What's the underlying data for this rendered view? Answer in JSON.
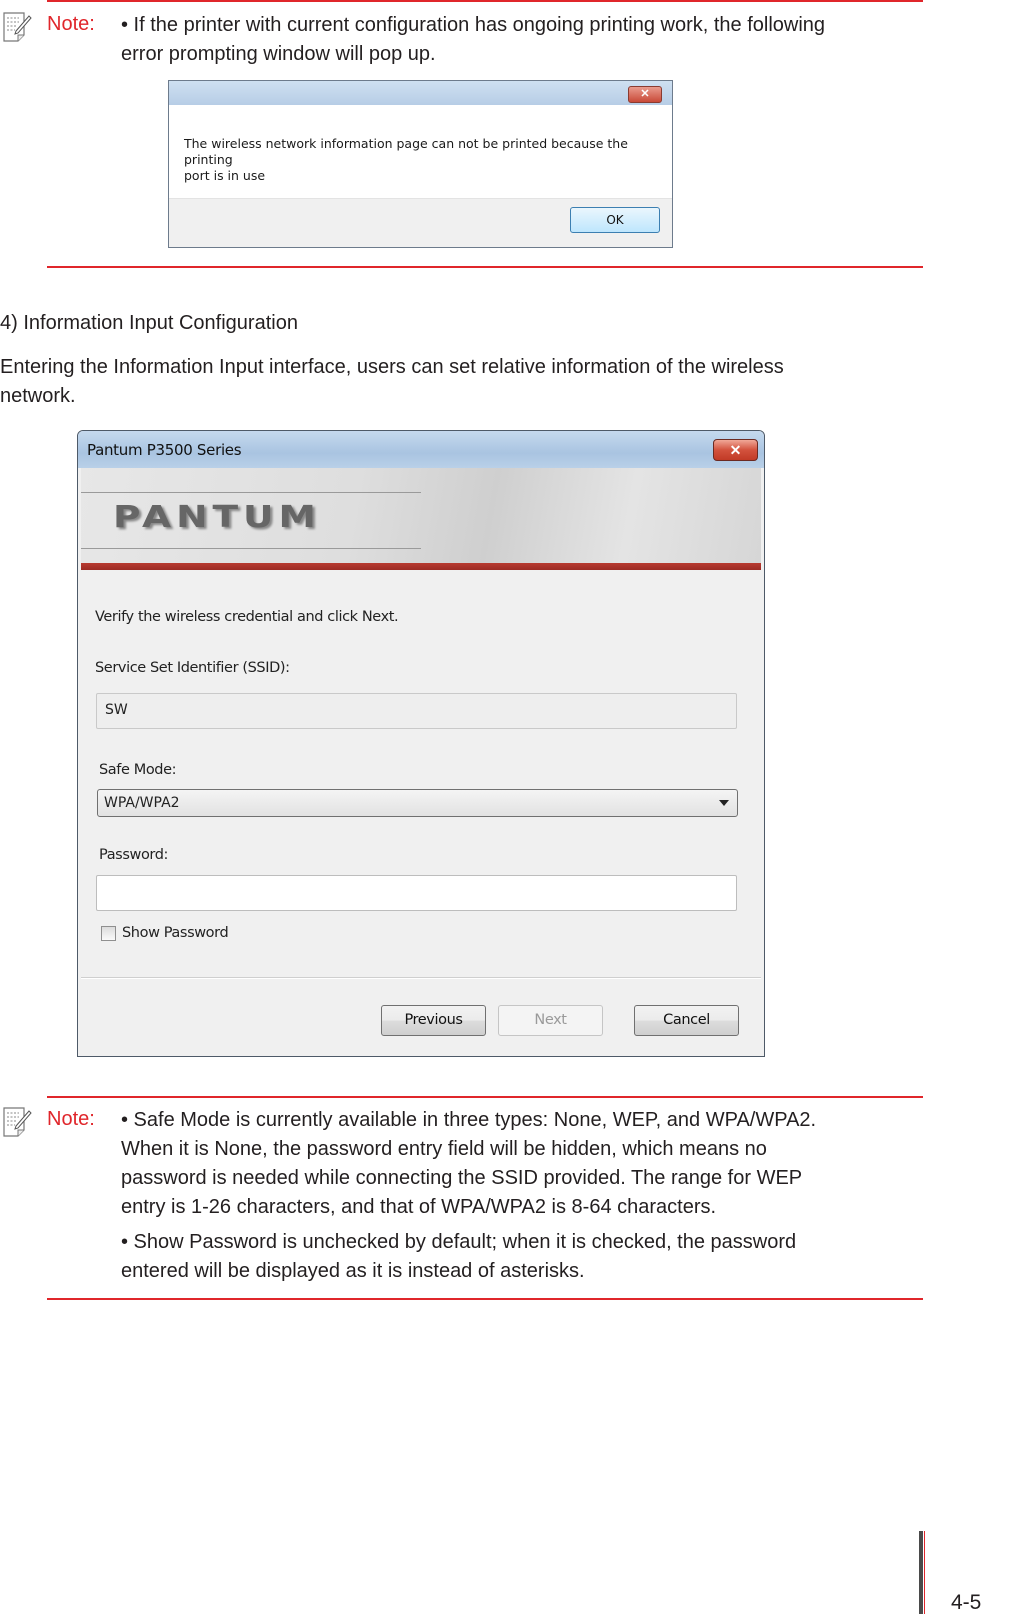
{
  "note1": {
    "label": "Note:",
    "line1": "• If the printer with current configuration has ongoing printing work, the following",
    "line2": "error prompting window will pop up."
  },
  "error_dialog": {
    "close_glyph": "✕",
    "message_line1": "The wireless network information page can not be printed because the printing",
    "message_line2": "port is in use",
    "ok_label": "OK"
  },
  "section": {
    "heading": "4) Information Input Configuration",
    "para_line1": "Entering the Information Input interface, users can set relative information of the wireless",
    "para_line2": "network."
  },
  "main_dialog": {
    "title": "Pantum P3500 Series",
    "close_glyph": "✕",
    "logo": "PANTUM",
    "instruction": "Verify the wireless credential and click Next.",
    "ssid_label": "Service Set Identifier (SSID):",
    "ssid_value": "SW",
    "safe_mode_label": "Safe Mode:",
    "safe_mode_value": "WPA/WPA2",
    "password_label": "Password:",
    "password_value": "",
    "show_password_label": "Show Password",
    "show_password_checked": false,
    "buttons": {
      "previous": "Previous",
      "next": "Next",
      "cancel": "Cancel"
    },
    "accent_color": "#a8322a"
  },
  "note2": {
    "label": "Note:",
    "lines": [
      "• Safe Mode is currently available in three types: None, WEP, and WPA/WPA2.",
      "When it is None, the password entry field will be hidden, which means no",
      "password is needed while connecting the SSID provided. The range for WEP",
      "entry is 1-26 characters,  and that of WPA/WPA2 is 8-64 characters."
    ],
    "lines2": [
      "• Show Password is unchecked by default; when it is checked, the password",
      "entered will be displayed as it is instead of asterisks."
    ]
  },
  "footer": {
    "page_number": "4-5"
  },
  "colors": {
    "note_red": "#e0262b",
    "text": "#231f20"
  }
}
